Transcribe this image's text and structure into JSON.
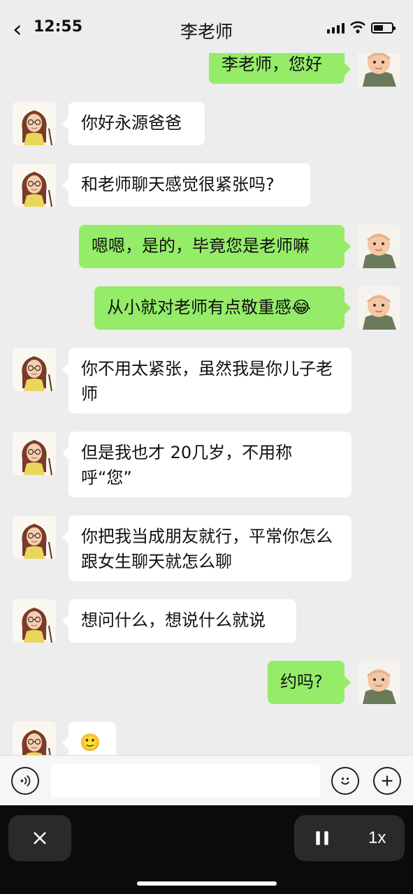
{
  "status_bar": {
    "time": "12:55"
  },
  "header": {
    "back_icon": "chevron-left-icon",
    "title": "李老师"
  },
  "messages": [
    {
      "from": "me",
      "text": "李老师，您好"
    },
    {
      "from": "teacher",
      "text": "你好永源爸爸"
    },
    {
      "from": "teacher",
      "text": "和老师聊天感觉很紧张吗?"
    },
    {
      "from": "me",
      "text": "嗯嗯，是的，毕竟您是老师嘛"
    },
    {
      "from": "me",
      "text": "从小就对老师有点敬重感",
      "emoji": "😂"
    },
    {
      "from": "teacher",
      "text": "你不用太紧张，虽然我是你儿子老师"
    },
    {
      "from": "teacher",
      "text": "但是我也才 20几岁，不用称呼“您”"
    },
    {
      "from": "teacher",
      "text": "你把我当成朋友就行，平常你怎么跟女生聊天就怎么聊"
    },
    {
      "from": "teacher",
      "text": "想问什么，想说什么就说"
    },
    {
      "from": "me",
      "text": "约吗?"
    },
    {
      "from": "teacher",
      "text": "",
      "emoji": "🙂"
    }
  ],
  "input_bar": {
    "voice_icon": "voice-icon",
    "emoji_icon": "emoji-icon",
    "plus_icon": "plus-icon"
  },
  "overlay": {
    "close_icon": "close-icon",
    "pause_icon": "pause-icon",
    "speed": "1x"
  },
  "colors": {
    "bg": "#ededed",
    "bubble_out": "#95ec69",
    "bubble_in": "#ffffff"
  }
}
